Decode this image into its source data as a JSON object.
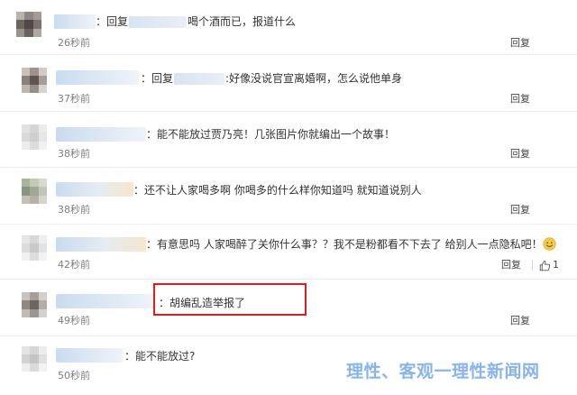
{
  "reply_label": "回复",
  "comments": [
    {
      "prefix": "：回复",
      "text": "喝个酒而已，报道什么",
      "time": "26秒前",
      "reply": "回复"
    },
    {
      "prefix": "：回复",
      "text": ":好像没说官宣离婚啊，怎么说他单身",
      "time": "37秒前",
      "reply": "回复"
    },
    {
      "prefix": "：",
      "text": "能不能放过贾乃亮！几张图片你就编出一个故事！",
      "time": "38秒前",
      "reply": "回复"
    },
    {
      "prefix": "：",
      "text": "还不让人家喝多啊 你喝多的什么样你知道吗 就知道说别人",
      "time": "38秒前",
      "reply": "回复"
    },
    {
      "prefix": "：",
      "text": "有意思吗 人家喝醉了关你什么事？？我不是粉都看不下去了 给别人一点隐私吧！",
      "emoji": "smile-emoji",
      "time": "42秒前",
      "reply": "回复",
      "likes": "1"
    },
    {
      "prefix": "：",
      "text": "胡编乱造举报了",
      "time": "49秒前",
      "reply": "回复"
    },
    {
      "prefix": "：",
      "text": "能不能放过?",
      "time": "50秒前",
      "reply": "回复"
    }
  ],
  "watermark": "理性、客观一理性新闻网",
  "colors": {
    "highlight": "#e01e1e",
    "watermark": "#5f9be6",
    "time": "#7d7d7d"
  },
  "icons": {
    "like": "thumbs-up-icon",
    "emoji": "smile-emoji"
  }
}
